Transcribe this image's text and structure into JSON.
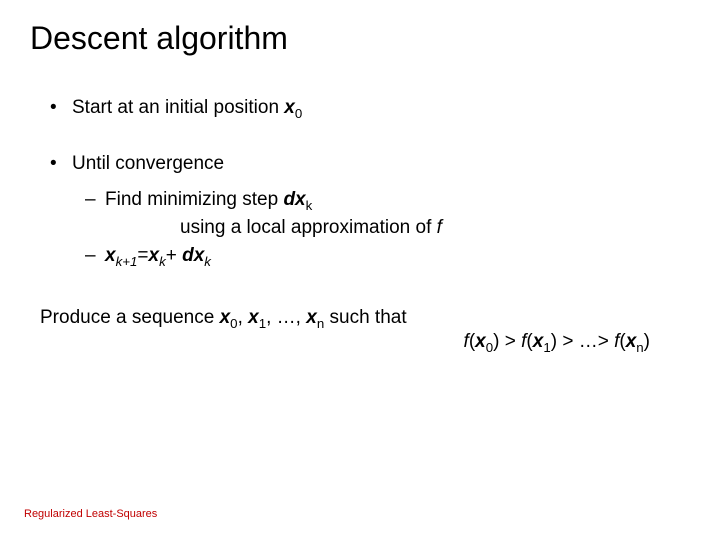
{
  "title": "Descent algorithm",
  "bullets": {
    "l1a_pre": "Start at an initial position ",
    "l1a_var": "x",
    "l1a_sub": "0",
    "l1b": "Until convergence",
    "l2a_pre": "Find minimizing step ",
    "l2a_dvar": "dx",
    "l2a_sub": "k",
    "l2a_sub2_pre": "using a local approximation of ",
    "l2a_f": "f",
    "l2b_xk1_x": "x",
    "l2b_xk1_sub": "k+1",
    "l2b_eq": "=",
    "l2b_xk_x": "x",
    "l2b_xk_sub": "k",
    "l2b_plus": "+ ",
    "l2b_dxk_dx": "dx",
    "l2b_dxk_sub": "k"
  },
  "produce": {
    "pre": "Produce a sequence ",
    "x": "x",
    "s0": "0",
    "s1": "1",
    "sn": "n",
    "dots": ", …, ",
    "comma": ", ",
    "such": " such that",
    "f": "f",
    "op_gt": " > ",
    "end_dots": " > …> ",
    "lp": "(",
    "rp": ")"
  },
  "footer": "Regularized Least-Squares"
}
